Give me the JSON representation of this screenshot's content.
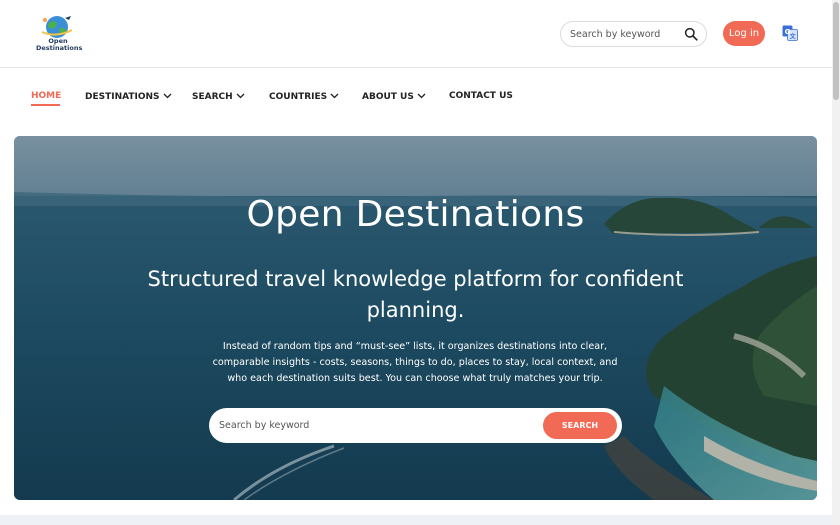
{
  "header": {
    "logo": {
      "line1": "Open",
      "line2": "Destinations"
    },
    "search": {
      "placeholder": "Search by keyword",
      "value": ""
    },
    "login_label": "Log in",
    "translate_icon": "translate-icon"
  },
  "nav": {
    "items": [
      {
        "label": "HOME",
        "active": true
      },
      {
        "label": "DESTINATIONS",
        "dropdown": true
      },
      {
        "label": "SEARCH",
        "dropdown": true
      },
      {
        "label": "COUNTRIES",
        "dropdown": true
      },
      {
        "label": "ABOUT US",
        "dropdown": true
      },
      {
        "label": "CONTACT US"
      }
    ]
  },
  "hero": {
    "title": "Open Destinations",
    "subtitle": "Structured travel knowledge platform for confident planning.",
    "description": "Instead of random tips and “must-see” lists, it organizes destinations into clear, comparable insights - costs, seasons, things to do, places to stay, local context, and who each destination suits best. You can choose what truly matches your trip.",
    "search": {
      "placeholder": "Search by keyword",
      "button_label": "SEARCH"
    }
  },
  "colors": {
    "accent": "#f06a55",
    "text": "#222222",
    "sea_dark": "#1e4a63",
    "sea_light": "#3f7c93"
  }
}
